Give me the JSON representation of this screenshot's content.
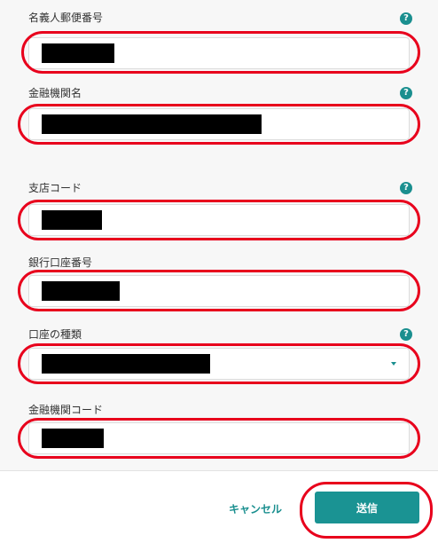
{
  "form": {
    "fields": [
      {
        "label": "名義人郵便番号",
        "has_help": true
      },
      {
        "label": "金融機関名",
        "has_help": true
      },
      {
        "label": "支店コード",
        "has_help": true
      },
      {
        "label": "銀行口座番号",
        "has_help": false
      },
      {
        "label": "口座の種類",
        "has_help": true
      },
      {
        "label": "金融機関コード",
        "has_help": false
      }
    ],
    "help_glyph": "?"
  },
  "footer": {
    "cancel_label": "キャンセル",
    "submit_label": "送信"
  },
  "colors": {
    "accent": "#1a9393",
    "annotation": "#e8001c",
    "redaction": "#000000"
  },
  "icons": [
    "help-icon",
    "chevron-down-icon"
  ]
}
